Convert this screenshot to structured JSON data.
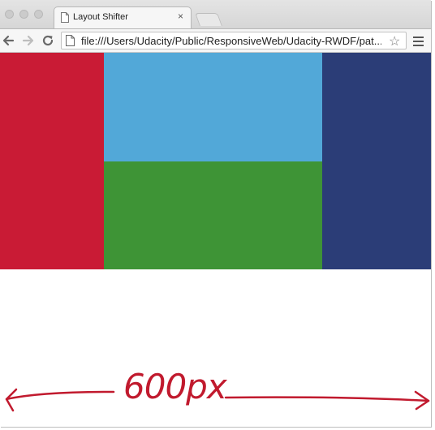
{
  "browser": {
    "tab": {
      "title": "Layout Shifter",
      "close_glyph": "×",
      "icon": "document-icon"
    },
    "toolbar": {
      "back_icon": "arrow-left-icon",
      "forward_icon": "arrow-right-icon",
      "reload_icon": "reload-icon",
      "url": "file:///Users/Udacity/Public/ResponsiveWeb/Udacity-RWDF/pat...",
      "bookmark_glyph": "☆",
      "menu_icon": "hamburger-menu-icon"
    }
  },
  "page": {
    "boxes": [
      {
        "name": "red",
        "color": "#c91b35"
      },
      {
        "name": "light-blue",
        "color": "#52a8d8"
      },
      {
        "name": "green",
        "color": "#3e9436"
      },
      {
        "name": "dark-blue",
        "color": "#2b3d77"
      }
    ]
  },
  "annotation": {
    "label": "600px",
    "color": "#c11a2e",
    "left_arrow_icon": "arrow-left-icon",
    "right_arrow_icon": "arrow-right-icon"
  },
  "colors": {
    "chrome_bg": "#f6f6f6",
    "titlebar_bg": "#d6d6d6"
  }
}
